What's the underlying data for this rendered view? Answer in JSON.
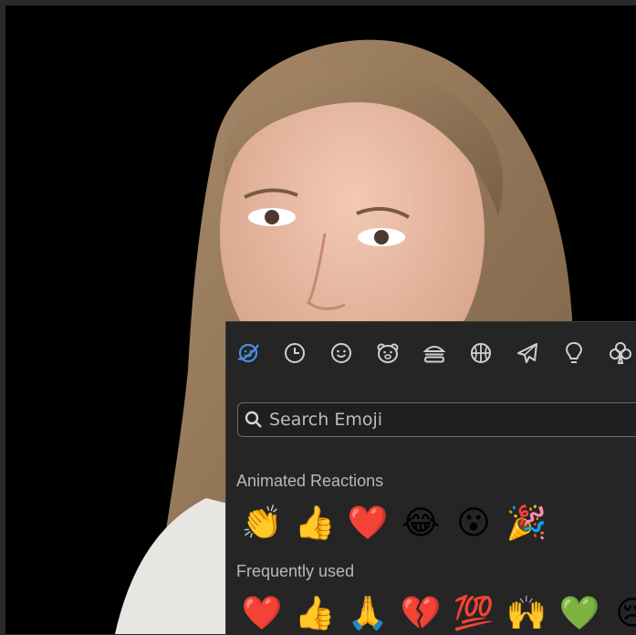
{
  "video": {
    "participant": "video-feed"
  },
  "emoji_picker": {
    "categories": [
      {
        "name": "animated-reactions",
        "icon": "face-planet-icon",
        "active": true
      },
      {
        "name": "recent",
        "icon": "clock-icon"
      },
      {
        "name": "smileys",
        "icon": "smiley-icon"
      },
      {
        "name": "animals",
        "icon": "bear-icon"
      },
      {
        "name": "food",
        "icon": "burger-icon"
      },
      {
        "name": "activities",
        "icon": "basketball-icon"
      },
      {
        "name": "travel",
        "icon": "airplane-icon"
      },
      {
        "name": "objects",
        "icon": "lightbulb-icon"
      },
      {
        "name": "symbols",
        "icon": "club-icon"
      }
    ],
    "search": {
      "placeholder": "Search Emoji"
    },
    "sections": {
      "animated": {
        "label": "Animated Reactions",
        "emojis": [
          "👏",
          "👍",
          "❤️",
          "😂",
          "😮",
          "🎉"
        ]
      },
      "frequent": {
        "label": "Frequently used",
        "emojis": [
          "❤️",
          "👍",
          "🙏",
          "💔",
          "💯",
          "🙌",
          "💚",
          "😢"
        ]
      }
    },
    "accent_color": "#4a8fe0"
  }
}
